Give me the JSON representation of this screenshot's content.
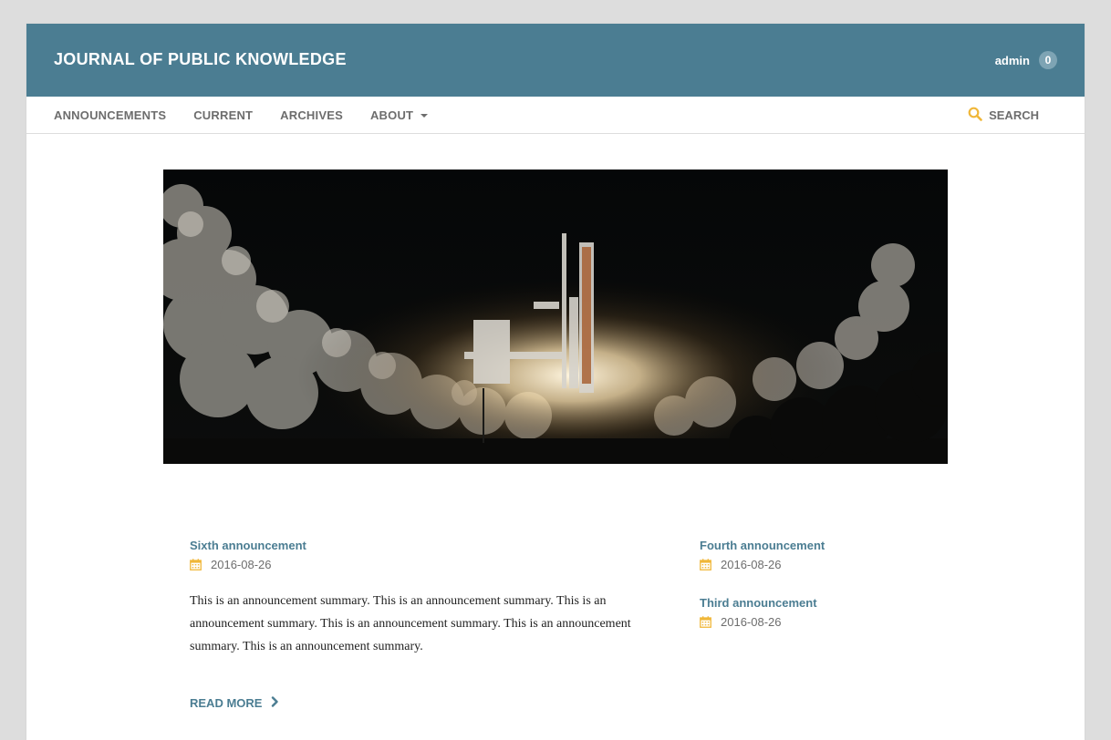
{
  "header": {
    "site_title": "JOURNAL OF PUBLIC KNOWLEDGE",
    "username": "admin",
    "task_count": "0"
  },
  "nav": {
    "items": [
      {
        "label": "ANNOUNCEMENTS"
      },
      {
        "label": "CURRENT"
      },
      {
        "label": "ARCHIVES"
      },
      {
        "label": "ABOUT"
      }
    ],
    "search_label": "SEARCH"
  },
  "announcements": {
    "featured": {
      "title": "Sixth announcement",
      "date": "2016-08-26",
      "summary": "This is an announcement summary. This is an announcement summary. This is an announcement summary. This is an announcement summary. This is an announcement summary. This is an announcement summary.",
      "read_more": "READ MORE"
    },
    "others": [
      {
        "title": "Fourth announcement",
        "date": "2016-08-26"
      },
      {
        "title": "Third announcement",
        "date": "2016-08-26"
      }
    ]
  },
  "colors": {
    "header_bg": "#4b7d92",
    "link": "#4b7d92",
    "icon_accent": "#f0b739",
    "nav_text": "#6d6d6d",
    "page_bg": "#dddddd"
  },
  "icons": {
    "search": "search-icon",
    "calendar": "calendar-icon",
    "read_more": "chevron-right-icon",
    "about_menu": "caret-down-icon"
  }
}
